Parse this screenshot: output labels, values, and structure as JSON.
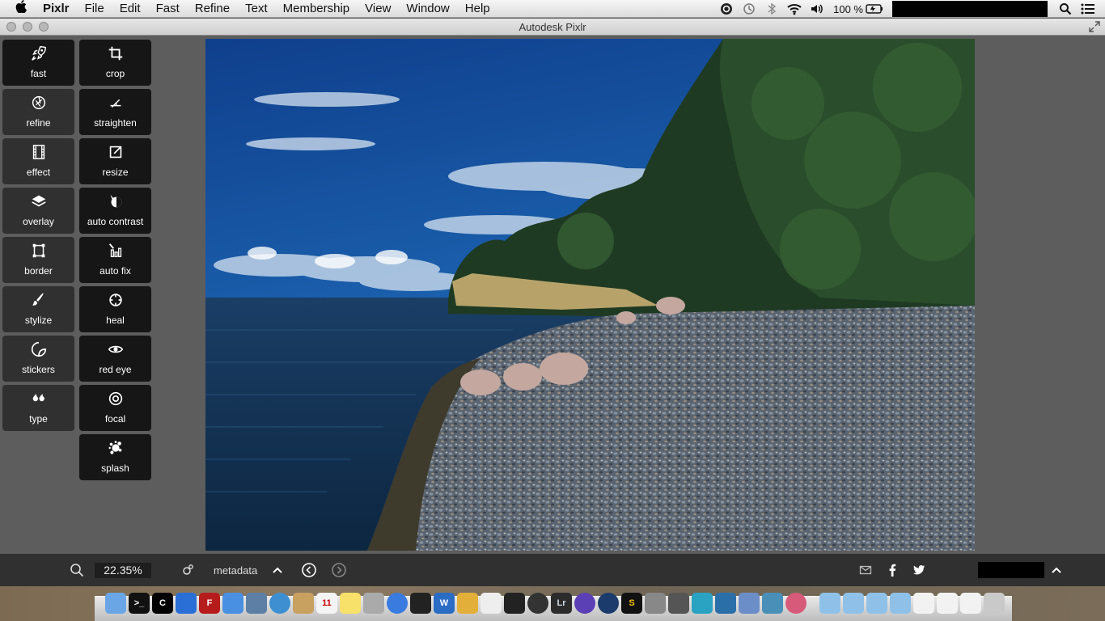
{
  "menubar": {
    "app_name": "Pixlr",
    "menus": [
      "File",
      "Edit",
      "Fast",
      "Refine",
      "Text",
      "Membership",
      "View",
      "Window",
      "Help"
    ],
    "battery": "100 %"
  },
  "window": {
    "title": "Autodesk Pixlr"
  },
  "tools": {
    "left": [
      {
        "label": "fast",
        "icon": "rocket-icon"
      },
      {
        "label": "refine",
        "icon": "aperture-icon"
      },
      {
        "label": "effect",
        "icon": "film-icon"
      },
      {
        "label": "overlay",
        "icon": "layers-icon"
      },
      {
        "label": "border",
        "icon": "border-icon"
      },
      {
        "label": "stylize",
        "icon": "brush-icon"
      },
      {
        "label": "stickers",
        "icon": "sticker-icon"
      },
      {
        "label": "type",
        "icon": "quote-icon"
      }
    ],
    "right": [
      {
        "label": "crop",
        "icon": "crop-icon"
      },
      {
        "label": "straighten",
        "icon": "angle-icon"
      },
      {
        "label": "resize",
        "icon": "resize-icon"
      },
      {
        "label": "auto contrast",
        "icon": "contrast-icon"
      },
      {
        "label": "auto fix",
        "icon": "wand-icon"
      },
      {
        "label": "heal",
        "icon": "crosshair-icon"
      },
      {
        "label": "red eye",
        "icon": "eye-icon"
      },
      {
        "label": "focal",
        "icon": "target-icon"
      },
      {
        "label": "splash",
        "icon": "splash-icon"
      }
    ]
  },
  "bottombar": {
    "zoom_value": "22.35%",
    "metadata_label": "metadata"
  }
}
